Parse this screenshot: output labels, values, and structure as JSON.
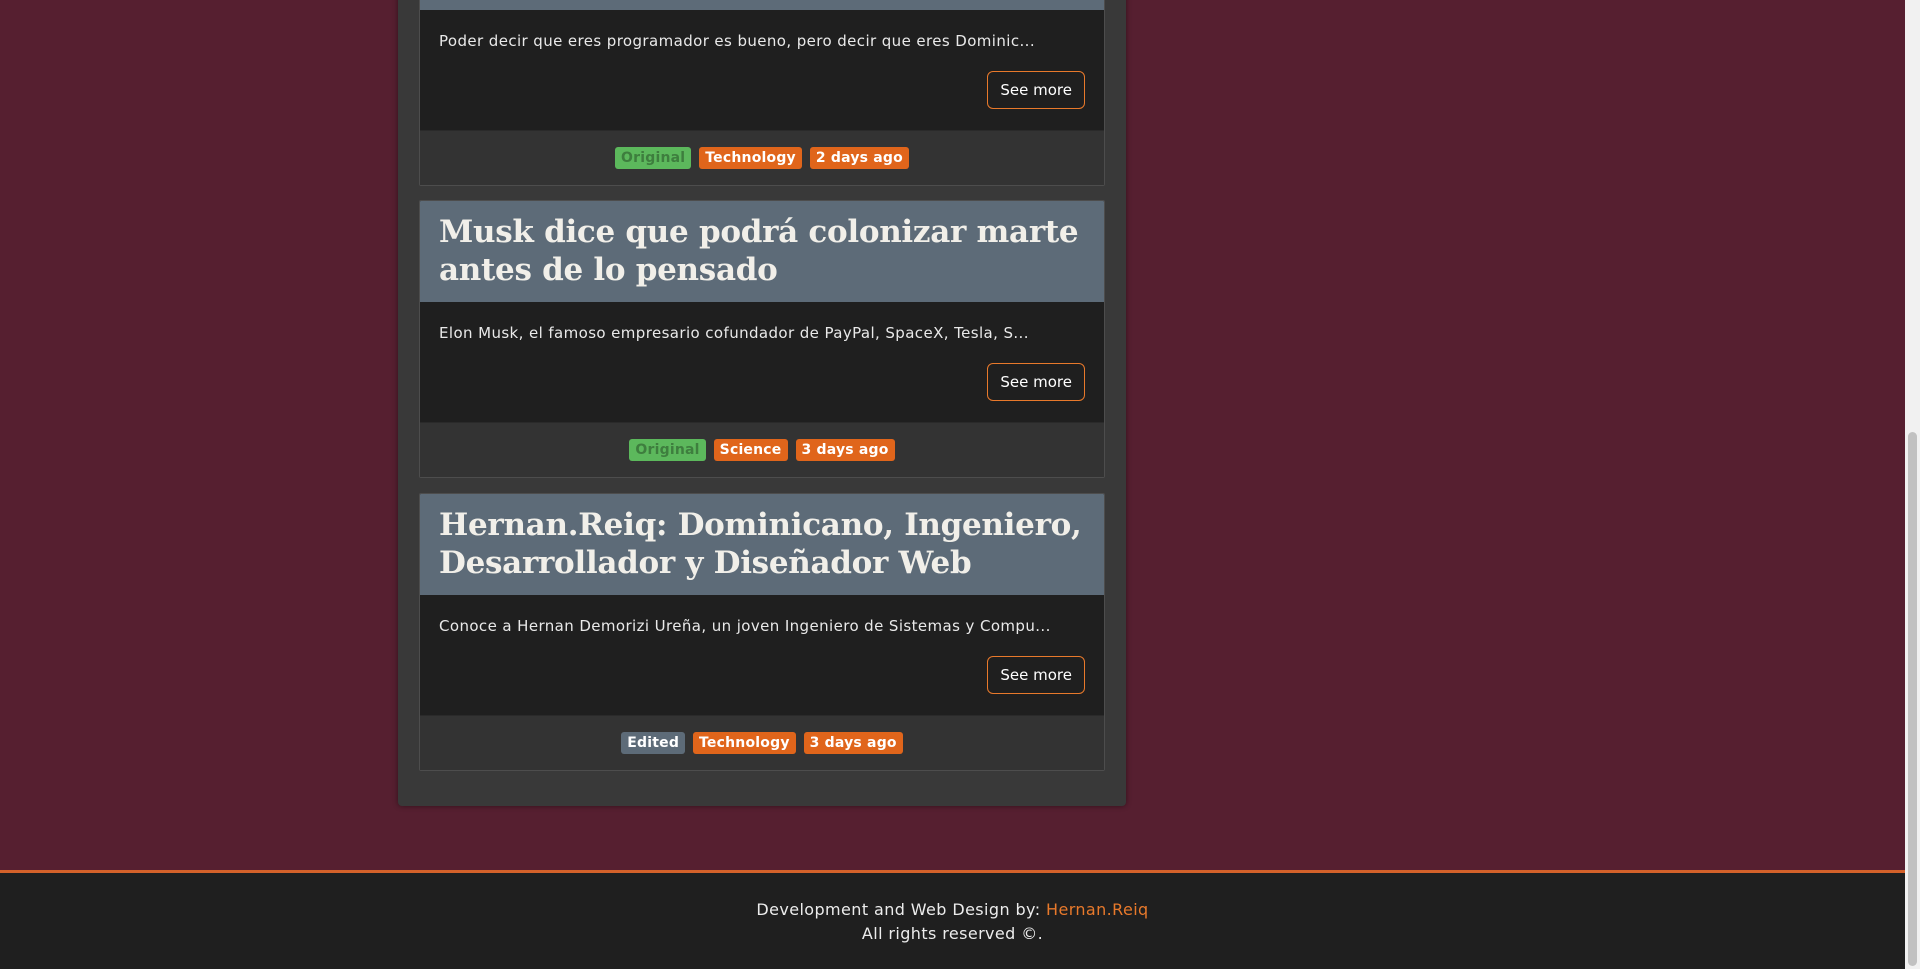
{
  "articles": [
    {
      "excerpt": "Poder decir que eres programador es bueno, pero decir que eres Dominic...",
      "see_more": "See more",
      "badges": {
        "status": "Original",
        "category": "Technology",
        "time": "2 days ago"
      }
    },
    {
      "title": "Musk dice que podrá colonizar marte antes de lo pensado",
      "excerpt": "Elon Musk, el famoso empresario cofundador de PayPal, SpaceX, Tesla, S...",
      "see_more": "See more",
      "badges": {
        "status": "Original",
        "category": "Science",
        "time": "3 days ago"
      }
    },
    {
      "title": "Hernan.Reiq: Dominicano, Ingeniero, Desarrollador y Diseñador Web",
      "excerpt": "Conoce a Hernan Demorizi Ureña, un joven Ingeniero de Sistemas y Compu...",
      "see_more": "See more",
      "badges": {
        "status": "Edited",
        "category": "Technology",
        "time": "3 days ago"
      }
    }
  ],
  "footer": {
    "credit_prefix": "Development and Web Design by: ",
    "credit_link": "Hernan.Reiq",
    "rights": "All rights reserved ©."
  },
  "colors": {
    "page_background": "#561f30",
    "accent": "#e0651b",
    "card_header": "#5d6b78",
    "original_badge": "#5cb85c"
  }
}
